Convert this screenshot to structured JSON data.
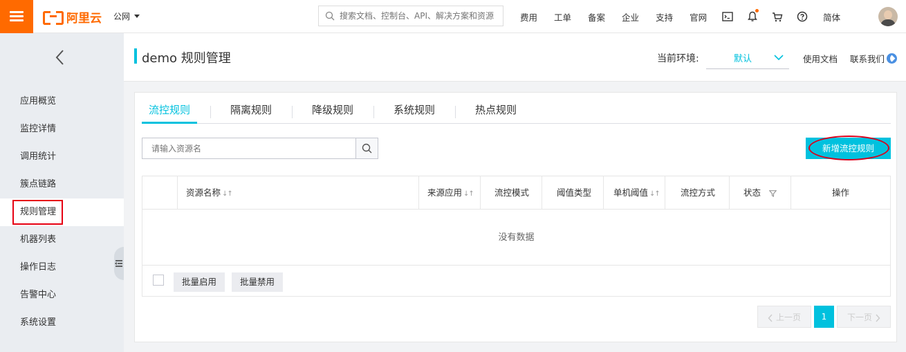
{
  "topbar": {
    "brand": "阿里云",
    "region": "公网",
    "search_placeholder": "搜索文档、控制台、API、解决方案和资源",
    "links": [
      "费用",
      "工单",
      "备案",
      "企业",
      "支持",
      "官网"
    ],
    "language": "简体"
  },
  "sidebar": {
    "items": [
      "应用概览",
      "监控详情",
      "调用统计",
      "簇点链路",
      "规则管理",
      "机器列表",
      "操作日志",
      "告警中心",
      "系统设置"
    ],
    "active_index": 4
  },
  "header": {
    "title": "demo 规则管理",
    "env_label": "当前环境:",
    "env_value": "默认",
    "doc_link": "使用文档",
    "contact_link": "联系我们"
  },
  "tabs": [
    "流控规则",
    "隔离规则",
    "降级规则",
    "系统规则",
    "热点规则"
  ],
  "active_tab": 0,
  "filter": {
    "placeholder": "请输入资源名"
  },
  "add_button": "新增流控规则",
  "table": {
    "columns": [
      "资源名称",
      "来源应用",
      "流控模式",
      "阈值类型",
      "单机阈值",
      "流控方式",
      "状态",
      "操作"
    ],
    "empty_text": "没有数据",
    "batch_enable": "批量启用",
    "batch_disable": "批量禁用"
  },
  "pagination": {
    "prev": "上一页",
    "current": "1",
    "next": "下一页"
  },
  "colors": {
    "brand": "#ff6a00",
    "accent": "#00c1de",
    "highlight": "#e60012"
  }
}
